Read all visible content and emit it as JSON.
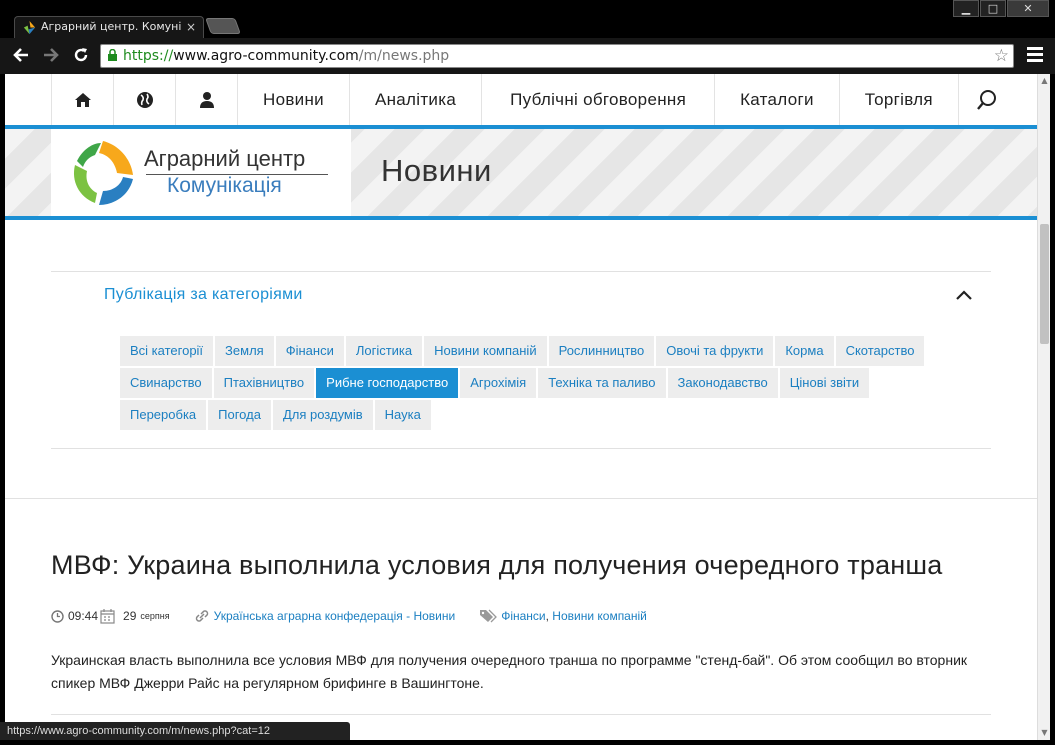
{
  "browser": {
    "tab_title": "Аграрний центр. Комунікаці",
    "tab_close": "×",
    "url_scheme": "https://",
    "url_host": "www.agro-community.com",
    "url_path": "/m/news.php",
    "status_url": "https://www.agro-community.com/m/news.php?cat=12",
    "window_buttons": [
      "▁",
      "□",
      "✕"
    ]
  },
  "site_nav": {
    "items": [
      "Новини",
      "Аналітика",
      "Публічні обговорення",
      "Каталоги",
      "Торгівля"
    ]
  },
  "header": {
    "logo_line1": "Аграрний центр",
    "logo_line2": "Комунікація",
    "page_title": "Новини"
  },
  "categories": {
    "heading": "Публікація за категоріями",
    "active_index": 9,
    "items": [
      "Всі категорії",
      "Земля",
      "Фінанси",
      "Логістика",
      "Новини компаній",
      "Рослинництво",
      "Овочі та фрукти",
      "Корма",
      "Скотарство",
      "Свинарство",
      "Птахівництво",
      "Рибне господарство",
      "Агрохімія",
      "Техніка та паливо",
      "Законодавство",
      "Цінові звіти",
      "Переробка",
      "Погода",
      "Для роздумів",
      "Наука"
    ]
  },
  "article": {
    "title": "МВФ: Украина выполнила условия для получения очередного транша",
    "time": "09:44",
    "date_day": "29",
    "date_month": "серпня",
    "source": "Українська аграрна конфедерація - Новини",
    "tag1": "Фінанси",
    "tag_sep": ", ",
    "tag2": "Новини компаній",
    "body": "Украинская власть выполнила все условия МВФ для получения очередного транша по программе \"стенд-бай\".  Об этом сообщил во вторник спикер МВФ Джерри Райс на регулярном брифинге в Вашингтоне."
  },
  "colors": {
    "accent": "#1b8fd3",
    "link": "#1b7fc1",
    "active_category_bg": "#1b8fd3"
  }
}
